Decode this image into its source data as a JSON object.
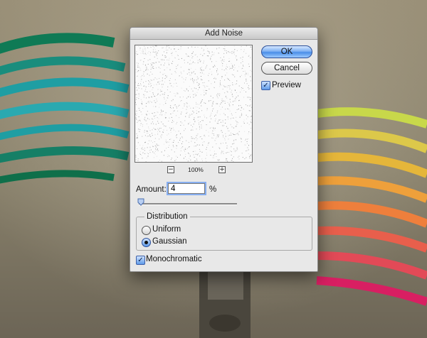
{
  "dialog": {
    "title": "Add Noise",
    "zoom": {
      "level": "100%",
      "zoom_out_symbol": "−",
      "zoom_in_symbol": "+"
    },
    "buttons": {
      "ok_label": "OK",
      "cancel_label": "Cancel"
    },
    "preview": {
      "label": "Preview",
      "checked": true
    },
    "amount": {
      "label": "Amount:",
      "value": "4",
      "unit": "%",
      "slider_fraction": 0.01
    },
    "distribution": {
      "title": "Distribution",
      "options": [
        {
          "label": "Uniform",
          "selected": false
        },
        {
          "label": "Gaussian",
          "selected": true
        }
      ]
    },
    "monochromatic": {
      "label": "Monochromatic",
      "checked": true
    }
  },
  "colors": {
    "accent": "#4a8ee8",
    "dialog_bg": "#e8e8e8",
    "left_ribbons": [
      "#0f7a55",
      "#1a8d7d",
      "#1f9ea3",
      "#2aa9b0"
    ],
    "right_ribbons": [
      "#c8d84a",
      "#e5b63a",
      "#ee7f3c",
      "#e24a57",
      "#d81f62"
    ]
  },
  "icons": {
    "check": "checkmark-icon",
    "slider_thumb": "triangle-thumb-icon"
  }
}
